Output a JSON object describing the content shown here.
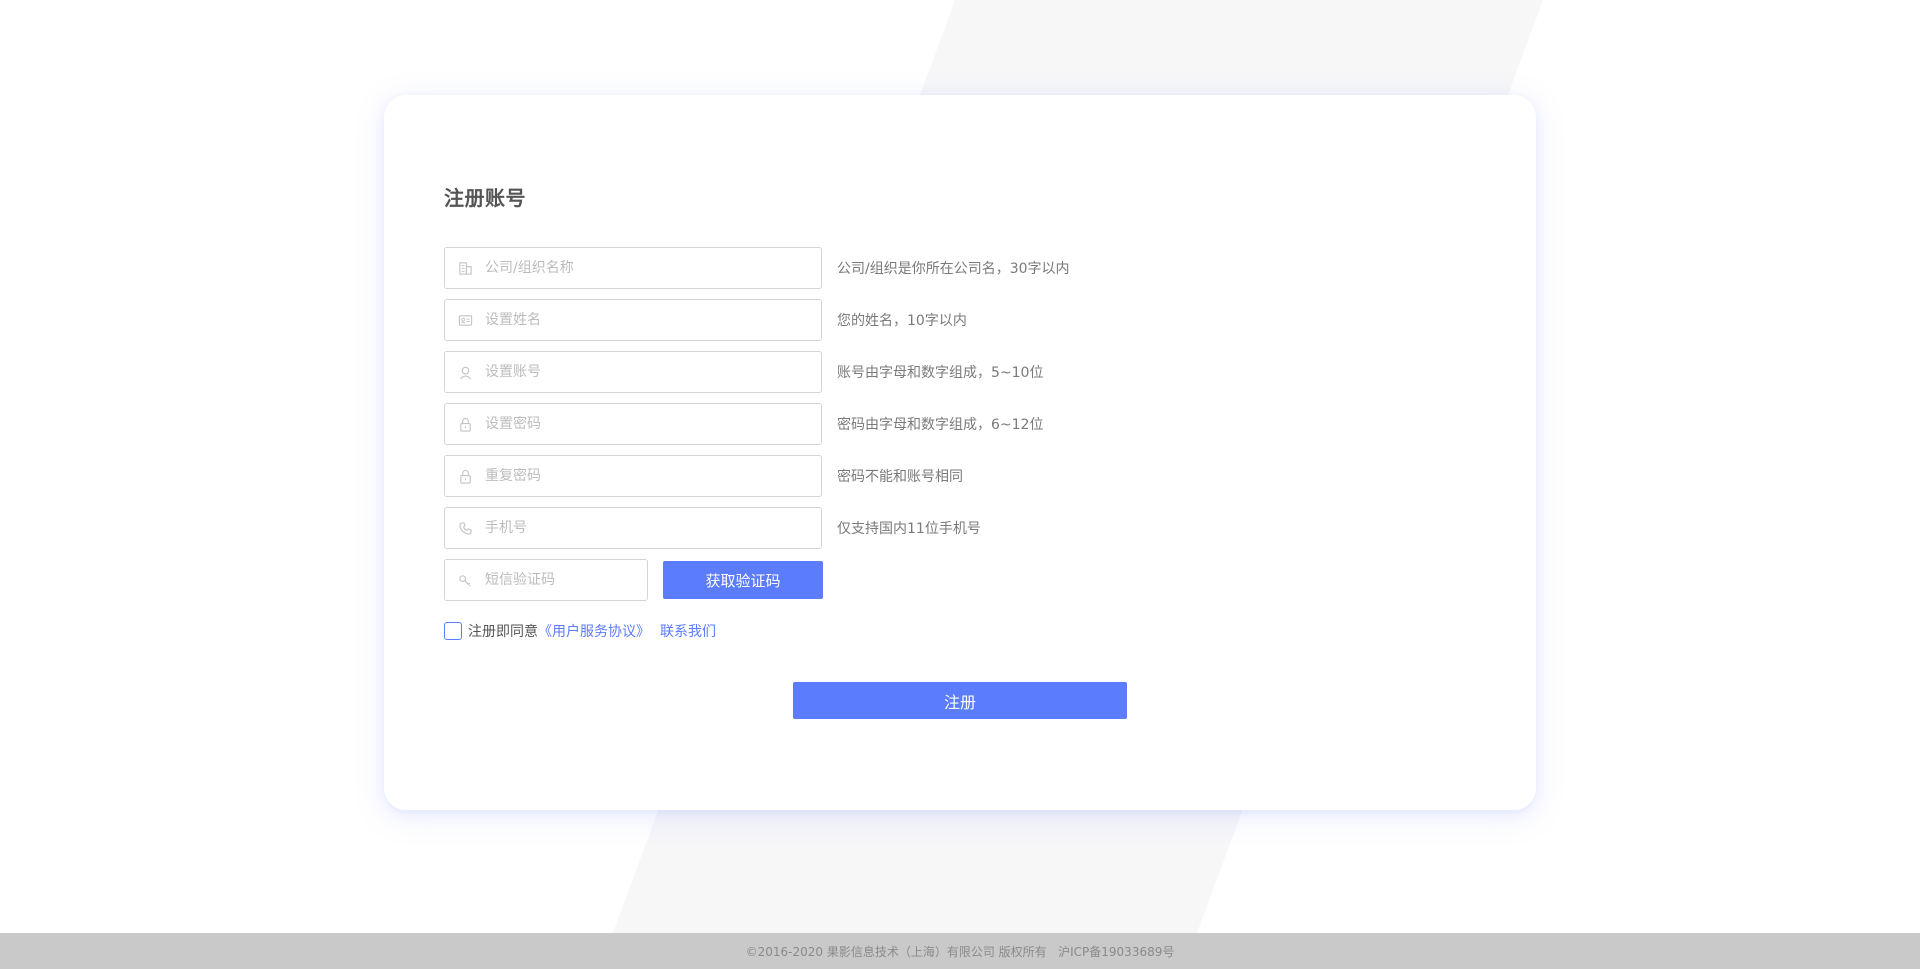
{
  "form": {
    "title": "注册账号",
    "fields": [
      {
        "placeholder": "公司/组织名称",
        "hint": "公司/组织是你所在公司名，30字以内",
        "icon": "building-icon"
      },
      {
        "placeholder": "设置姓名",
        "hint": "您的姓名，10字以内",
        "icon": "id-card-icon"
      },
      {
        "placeholder": "设置账号",
        "hint": "账号由字母和数字组成，5~10位",
        "icon": "user-icon"
      },
      {
        "placeholder": "设置密码",
        "hint": "密码由字母和数字组成，6~12位",
        "icon": "lock-icon"
      },
      {
        "placeholder": "重复密码",
        "hint": "密码不能和账号相同",
        "icon": "lock-icon"
      },
      {
        "placeholder": "手机号",
        "hint": "仅支持国内11位手机号",
        "icon": "phone-icon"
      }
    ],
    "sms": {
      "placeholder": "短信验证码",
      "icon": "key-icon",
      "button_label": "获取验证码"
    },
    "agreement": {
      "text": "注册即同意",
      "link_terms": "《用户服务协议》",
      "link_contact": "联系我们"
    },
    "submit_label": "注册"
  },
  "footer": {
    "text": "©2016-2020 果影信息技术（上海）有限公司 版权所有   沪ICP备19033689号"
  },
  "colors": {
    "primary": "#5b7cfd",
    "stripe": "#f7f7f8",
    "footer_bg": "#c9c9c9"
  }
}
